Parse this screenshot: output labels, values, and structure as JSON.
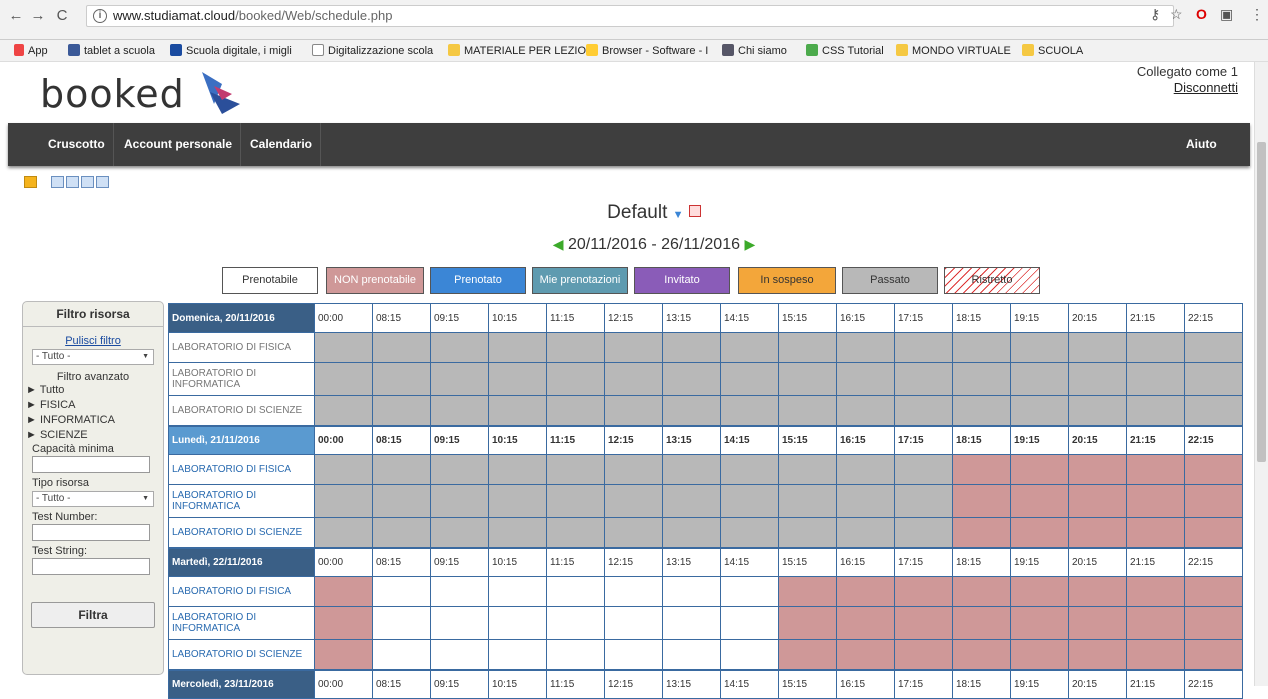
{
  "browser": {
    "url_host": "www.studiamat.cloud",
    "url_path": "/booked/Web/schedule.php",
    "bookmarks": [
      "App",
      "tablet a scuola",
      "Scuola digitale, i migli",
      "Digitalizzazione scola",
      "MATERIALE PER LEZIO",
      "Browser - Software - I",
      "Chi siamo",
      "CSS Tutorial",
      "MONDO VIRTUALE",
      "SCUOLA"
    ]
  },
  "header": {
    "logo": "booked",
    "logged_as": "Collegato come 1",
    "logout": "Disconnetti"
  },
  "nav": {
    "items": [
      "Cruscotto",
      "Account personale",
      "Calendario"
    ],
    "help": "Aiuto"
  },
  "schedule": {
    "title": "Default",
    "date_range": "20/11/2016 - 26/11/2016"
  },
  "legend": [
    {
      "label": "Prenotabile",
      "color": "#ffffff",
      "text": "#333333"
    },
    {
      "label": "NON prenotabile",
      "color": "#cf9898",
      "text": "#ffffff"
    },
    {
      "label": "Prenotato",
      "color": "#3b86d6",
      "text": "#ffffff"
    },
    {
      "label": "Mie prenotazioni",
      "color": "#5f9bb0",
      "text": "#ffffff"
    },
    {
      "label": "Invitato",
      "color": "#8a5cb8",
      "text": "#ffffff"
    },
    {
      "label": "In sospeso",
      "color": "#f3a63a",
      "text": "#333333"
    },
    {
      "label": "Passato",
      "color": "#b8b8b8",
      "text": "#333333"
    },
    {
      "label": "Ristretto",
      "color": "#ffffff",
      "text": "#333333"
    }
  ],
  "filter": {
    "title": "Filtro risorsa",
    "clear": "Pulisci filtro",
    "all_option": "- Tutto -",
    "advanced": "Filtro avanzato",
    "tree": [
      "Tutto",
      "FISICA",
      "INFORMATICA",
      "SCIENZE"
    ],
    "capacity_label": "Capacità minima",
    "type_label": "Tipo risorsa",
    "type_option": "- Tutto -",
    "number_label": "Test Number:",
    "string_label": "Test String:",
    "submit": "Filtra"
  },
  "times": [
    "00:00",
    "08:15",
    "09:15",
    "10:15",
    "11:15",
    "12:15",
    "13:15",
    "14:15",
    "15:15",
    "16:15",
    "17:15",
    "18:15",
    "19:15",
    "20:15",
    "21:15",
    "22:15"
  ],
  "days": [
    {
      "label": "Domenica, 20/11/2016",
      "pattern": "pppppppppppppppp"
    },
    {
      "label": "Lunedì, 21/11/2016",
      "pattern": "pppppppppppnnnnn"
    },
    {
      "label": "Martedì, 22/11/2016",
      "pattern": "nfffffffnnnnnnnnn"
    },
    {
      "label": "Mercoledì, 23/11/2016",
      "pattern": ""
    }
  ],
  "resources": [
    "LABORATORIO DI FISICA",
    "LABORATORIO DI INFORMATICA",
    "LABORATORIO DI SCIENZE"
  ]
}
